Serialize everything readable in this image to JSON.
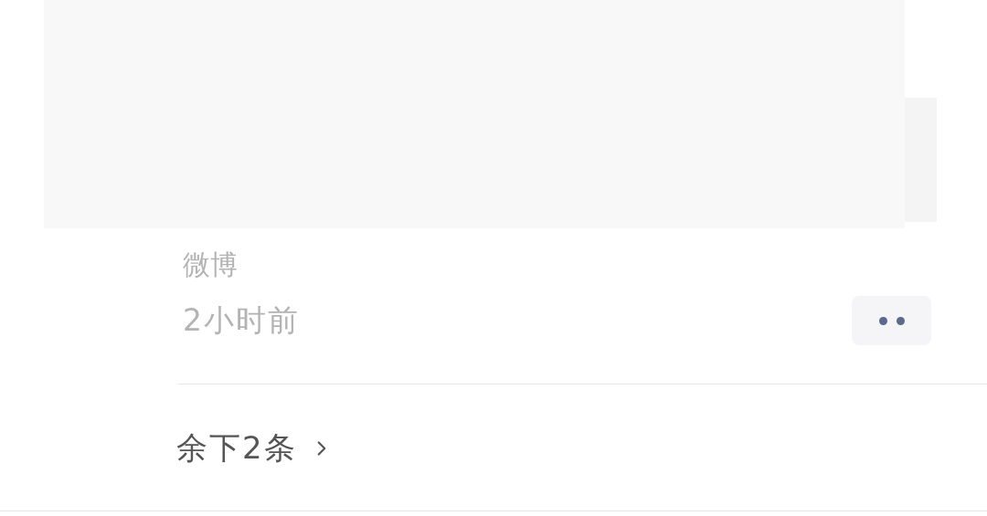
{
  "post": {
    "source": "微博",
    "time": "2小时前"
  },
  "more_link": {
    "label": "余下2条"
  }
}
